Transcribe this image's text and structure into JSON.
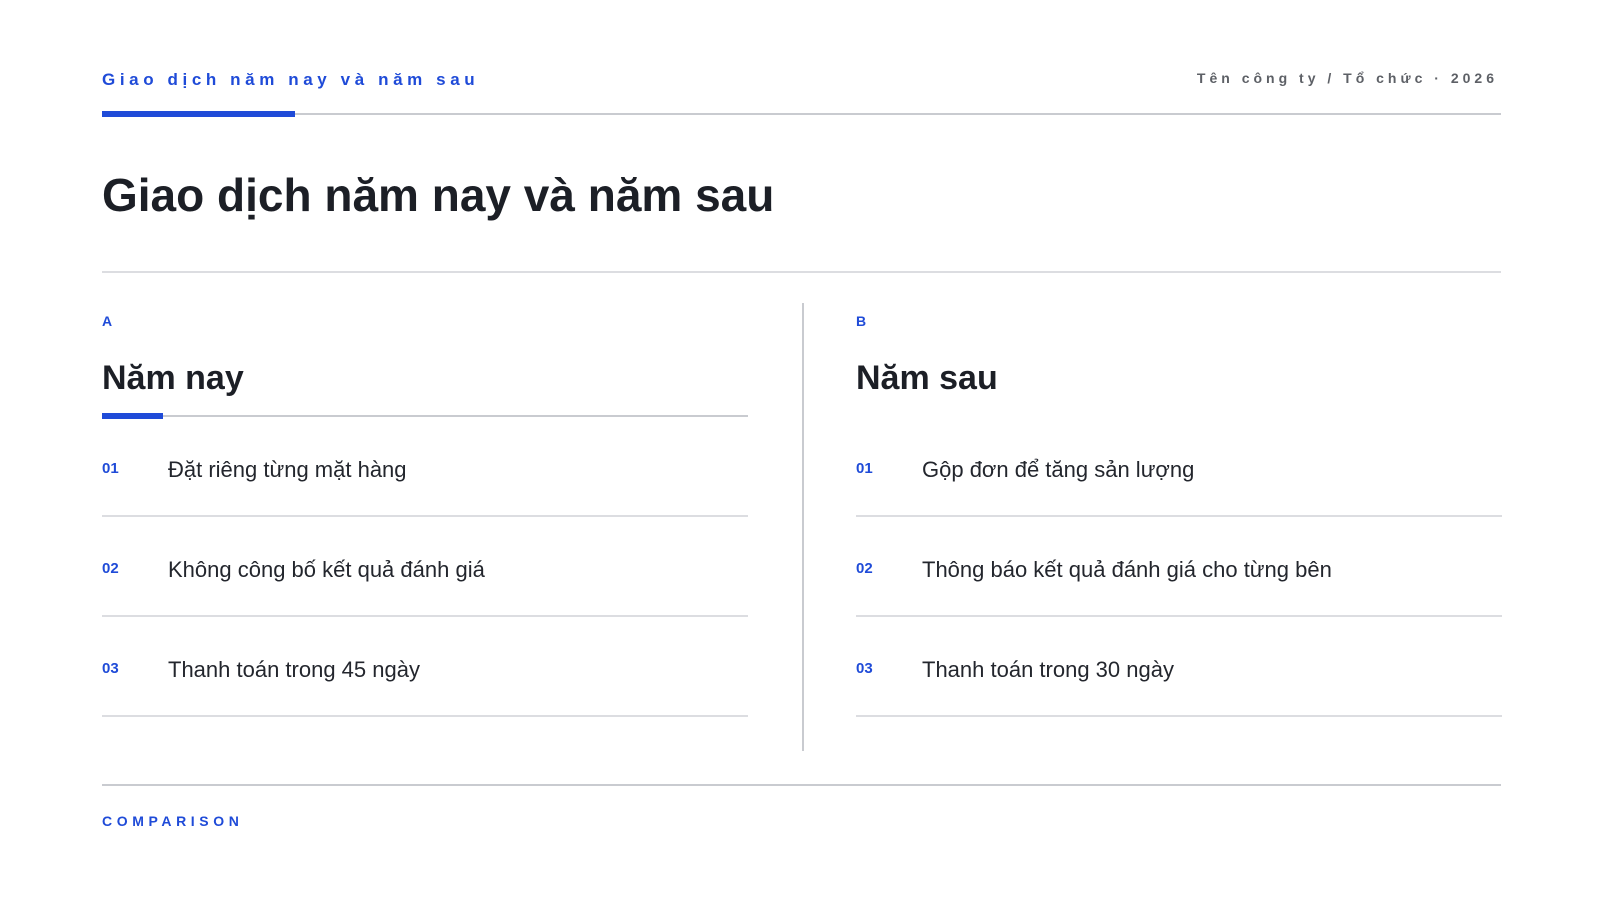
{
  "header": {
    "kicker": "Giao dịch năm nay và năm sau",
    "meta": "Tên công ty / Tổ chức · 2026"
  },
  "title": "Giao dịch năm nay và năm sau",
  "columns": [
    {
      "letter": "A",
      "heading": "Năm nay",
      "items": [
        {
          "num": "01",
          "text": "Đặt riêng từng mặt hàng"
        },
        {
          "num": "02",
          "text": "Không công bố kết quả đánh giá"
        },
        {
          "num": "03",
          "text": "Thanh toán trong 45 ngày"
        }
      ]
    },
    {
      "letter": "B",
      "heading": "Năm sau",
      "items": [
        {
          "num": "01",
          "text": "Gộp đơn để tăng sản lượng"
        },
        {
          "num": "02",
          "text": "Thông báo kết quả đánh giá cho từng bên"
        },
        {
          "num": "03",
          "text": "Thanh toán trong 30 ngày"
        }
      ]
    }
  ],
  "footer": {
    "label": "COMPARISON"
  },
  "colors": {
    "accent": "#1f4bd8",
    "text": "#1c1f26",
    "rule": "#c9cbd0"
  }
}
